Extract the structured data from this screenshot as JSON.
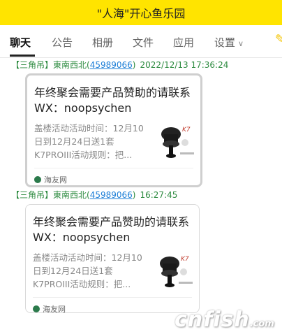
{
  "window": {
    "title": "\"人海\"开心鱼乐园"
  },
  "tabs": [
    {
      "label": "聊天"
    },
    {
      "label": "公告"
    },
    {
      "label": "相册"
    },
    {
      "label": "文件"
    },
    {
      "label": "应用"
    },
    {
      "label": "设置"
    }
  ],
  "messages": [
    {
      "tag": "【三角吊】",
      "sender": "東南西北",
      "qq": "45989066",
      "time": "2022/12/13 17:36:24",
      "card": {
        "title": "年终聚会需要产品赞助的请联系WX：noopsychen",
        "desc": "盖楼活动活动时间：12月10日到12月24日送1套K7PROIII活动规则：把...",
        "source": "海友网"
      }
    },
    {
      "tag": "【三角吊】",
      "sender": "東南西北",
      "qq": "45989066",
      "time": "16:27:45",
      "card": {
        "title": "年终聚会需要产品赞助的请联系WX：noopsychen",
        "desc": "盖楼活动活动时间：12月10日到12月24日送1套K7PROIII活动规则：把...",
        "source": "海友网"
      }
    }
  ],
  "watermark": {
    "text": "cnfish",
    "suffix": ".com"
  },
  "colors": {
    "titlebar": "#ffe400",
    "sender": "#2b8a3e",
    "link": "#1c7ed6"
  }
}
